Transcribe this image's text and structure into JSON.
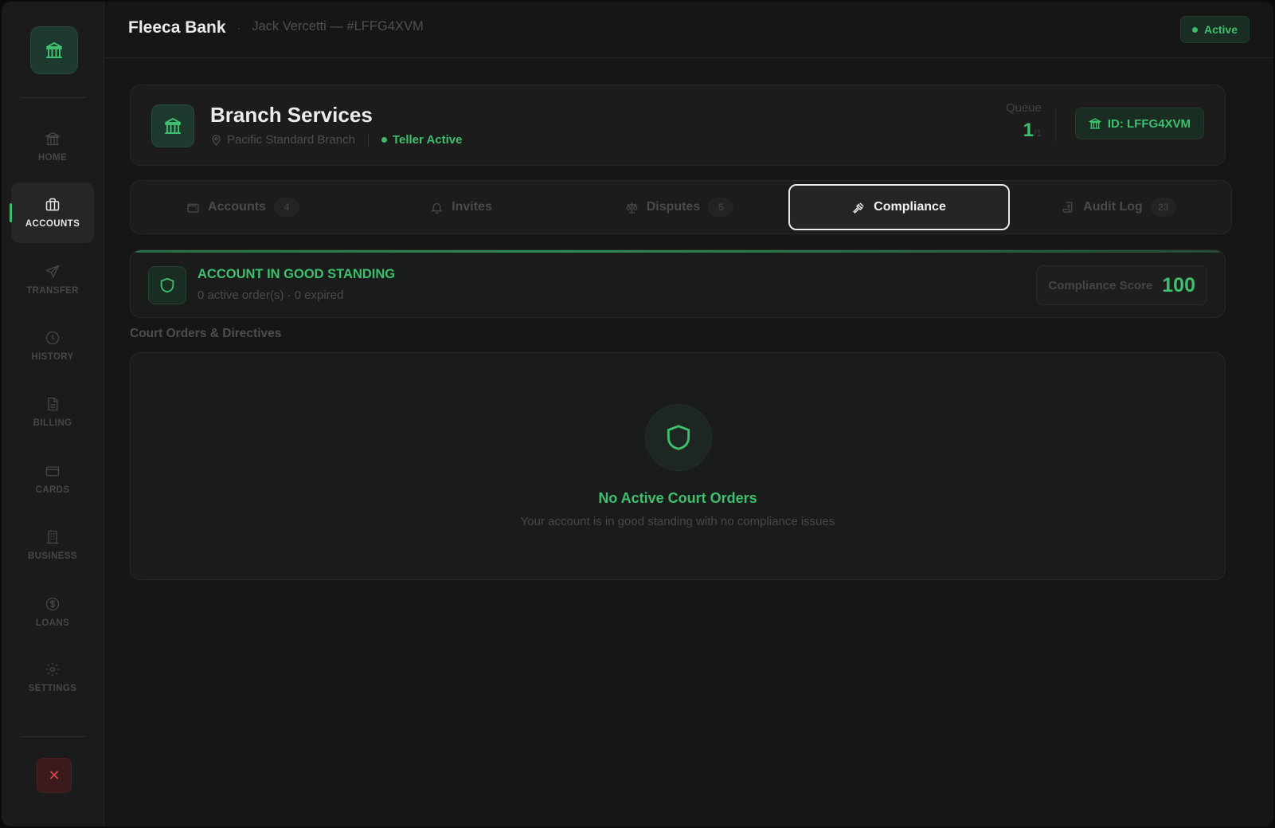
{
  "colors": {
    "accent_green": "#3fbf6e",
    "background": "#161616",
    "sidebar": "#1b1b1b",
    "danger": "#d24848"
  },
  "sidebar": {
    "logo_icon": "bank-icon",
    "items": [
      {
        "label": "HOME",
        "icon": "bank-icon",
        "active": false
      },
      {
        "label": "ACCOUNTS",
        "icon": "briefcase-icon",
        "active": true
      },
      {
        "label": "TRANSFER",
        "icon": "send-icon",
        "active": false
      },
      {
        "label": "HISTORY",
        "icon": "clock-icon",
        "active": false
      },
      {
        "label": "BILLING",
        "icon": "document-icon",
        "active": false
      },
      {
        "label": "CARDS",
        "icon": "card-icon",
        "active": false
      },
      {
        "label": "BUSINESS",
        "icon": "building-icon",
        "active": false
      },
      {
        "label": "LOANS",
        "icon": "dollar-icon",
        "active": false
      },
      {
        "label": "SETTINGS",
        "icon": "gear-icon",
        "active": false
      }
    ],
    "close_symbol": "✕"
  },
  "header": {
    "bank_name": "Fleeca Bank",
    "separator": "·",
    "customer": "Jack Vercetti — #LFFG4XVM",
    "status": "Active"
  },
  "branch": {
    "title": "Branch Services",
    "location": "Pacific Standard Branch",
    "teller_status": "Teller Active",
    "queue_label": "Queue",
    "queue_value": "1",
    "queue_total": "/1",
    "id_label": "ID: LFFG4XVM"
  },
  "tabs": [
    {
      "label": "Accounts",
      "count": "4",
      "icon": "wallet-icon",
      "active": false
    },
    {
      "label": "Invites",
      "count": "",
      "icon": "bell-icon",
      "active": false
    },
    {
      "label": "Disputes",
      "count": "5",
      "icon": "scale-icon",
      "active": false
    },
    {
      "label": "Compliance",
      "count": "",
      "icon": "gavel-icon",
      "active": true
    },
    {
      "label": "Audit Log",
      "count": "23",
      "icon": "log-icon",
      "active": false
    }
  ],
  "standing": {
    "title": "ACCOUNT IN GOOD STANDING",
    "subtitle": "0 active order(s) · 0 expired",
    "score_label": "Compliance Score",
    "score_value": "100"
  },
  "orders": {
    "section_title": "Court Orders & Directives",
    "empty_title": "No Active Court Orders",
    "empty_subtitle": "Your account is in good standing with no compliance issues"
  }
}
